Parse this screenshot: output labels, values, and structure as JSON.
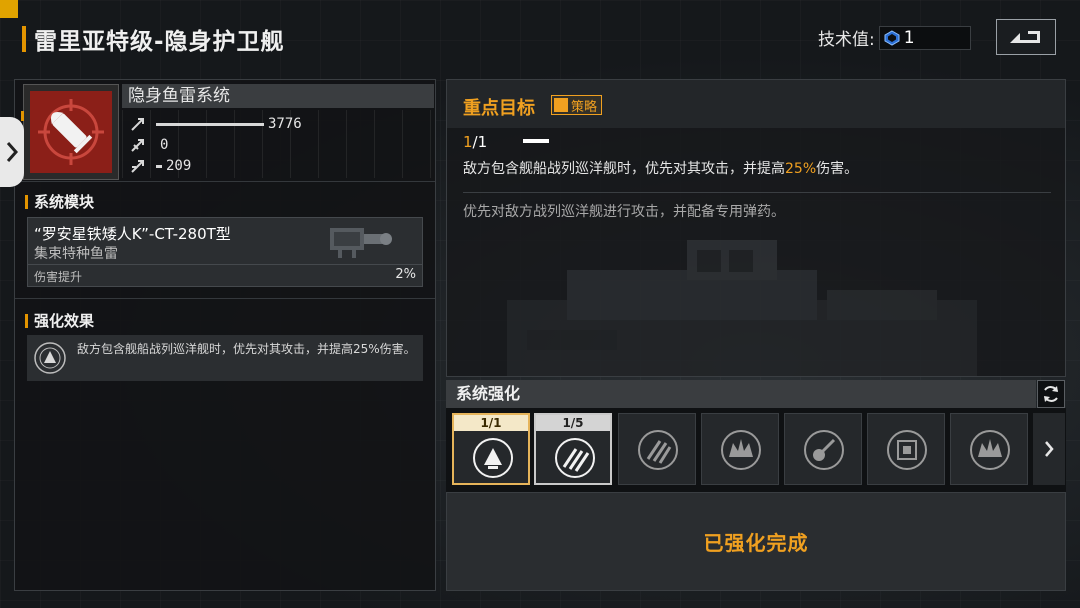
{
  "header": {
    "title": "雷里亚特级-隐身护卫舰",
    "tech_label": "技术值:",
    "tech_value": "1"
  },
  "system": {
    "name": "隐身鱼雷系统",
    "stats": [
      {
        "icon": "damage-icon",
        "value": "3776",
        "fill": 0.9
      },
      {
        "icon": "penetration-icon",
        "value": "0",
        "fill": 0.0
      },
      {
        "icon": "attack-speed-icon",
        "value": "209",
        "fill": 0.05
      }
    ]
  },
  "module_section": {
    "label": "系统模块",
    "name": "“罗安星铁矮人K”-CT-280T型",
    "sub": "集束特种鱼雷",
    "stat_label": "伤害提升",
    "stat_value": "2%"
  },
  "effect_section": {
    "label": "强化效果",
    "text": "敌方包含舰船战列巡洋舰时，优先对其攻击，并提高25%伤害。"
  },
  "objective": {
    "title": "重点目标",
    "badge": "策略",
    "progress_current": "1",
    "progress_sep": "/1",
    "text_before": "敌方包含舰船战列巡洋舰时，优先对其攻击，并提高",
    "text_highlight": "25%",
    "text_after": "伤害。",
    "sub_text": "优先对敌方战列巡洋舰进行攻击，并配备专用弹药。"
  },
  "enhancement": {
    "label": "系统强化",
    "items": [
      {
        "tag": "1/1",
        "icon": "target-strategy-icon"
      },
      {
        "tag": "1/5",
        "icon": "missile-salvo-icon"
      },
      {
        "tag": "",
        "icon": "torpedo-cluster-icon"
      },
      {
        "tag": "",
        "icon": "explosion-crown-icon"
      },
      {
        "tag": "",
        "icon": "guitar-rocket-icon"
      },
      {
        "tag": "",
        "icon": "chip-module-icon"
      },
      {
        "tag": "",
        "icon": "explosion-crown-icon"
      }
    ],
    "done_text": "已强化完成"
  },
  "colors": {
    "accent": "#f0a020",
    "weapon_card": "#8b1f18"
  }
}
